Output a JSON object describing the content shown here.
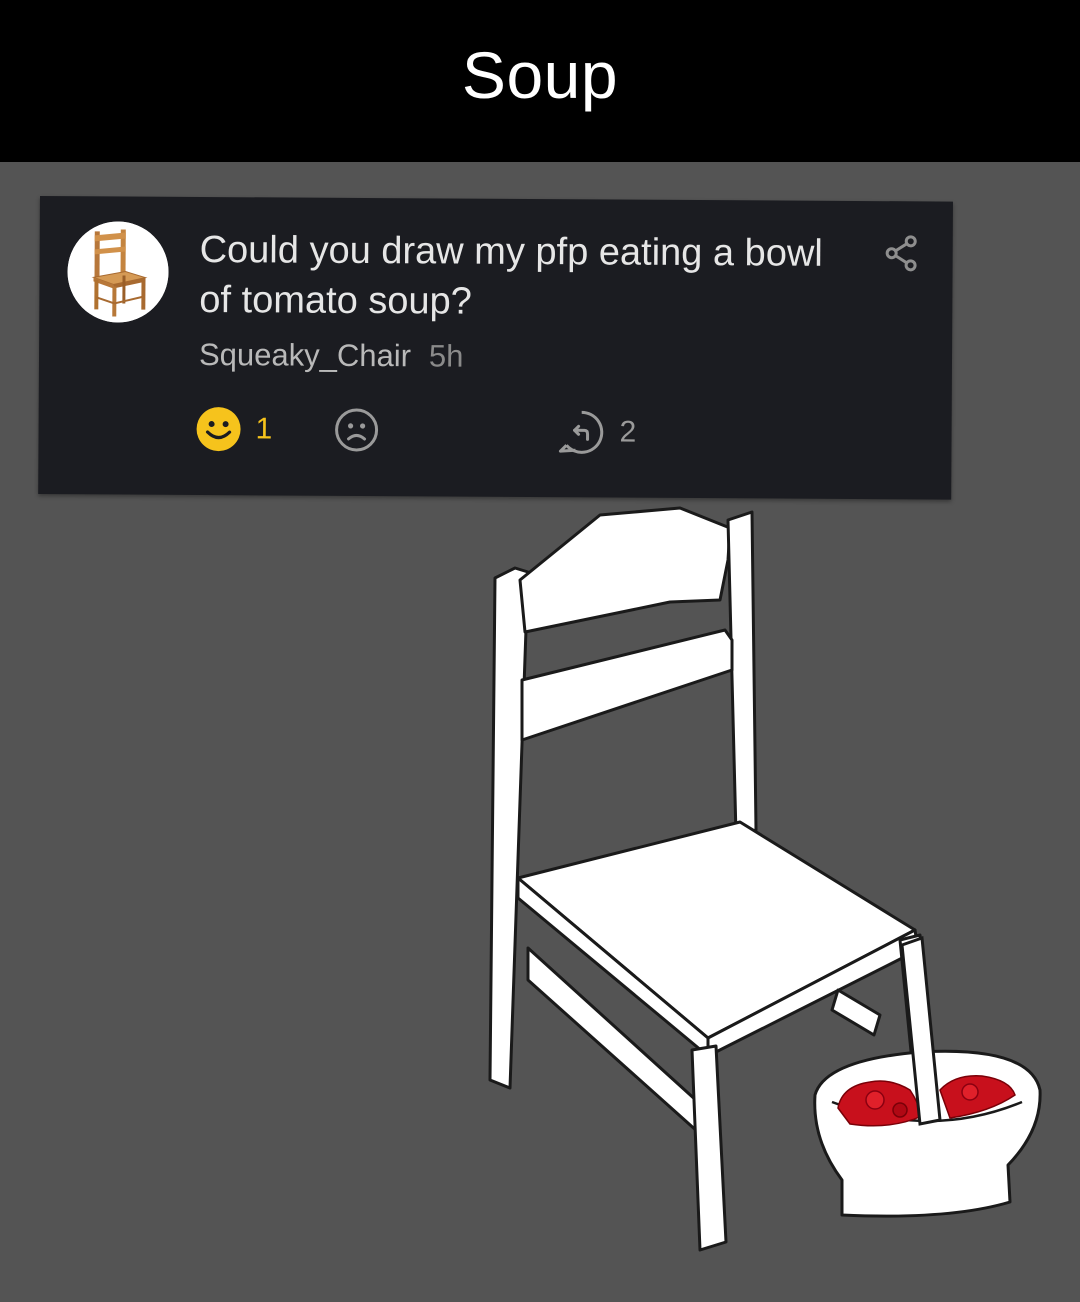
{
  "header": {
    "title": "Soup"
  },
  "post": {
    "question": "Could you draw my pfp eating a bowl of tomato soup?",
    "username": "Squeaky_Chair",
    "time": "5h",
    "reactions": {
      "happy_count": "1",
      "reply_count": "2"
    },
    "icons": {
      "avatar": "wooden-chair-avatar",
      "share": "share-icon",
      "happy": "smiley-face-icon",
      "sad": "sad-face-icon",
      "reply": "reply-arrow-icon"
    }
  },
  "colors": {
    "title_bar": "#000000",
    "background": "#545454",
    "card": "#1b1c21",
    "happy_active": "#f6c31c",
    "soup": "#c8101c"
  }
}
